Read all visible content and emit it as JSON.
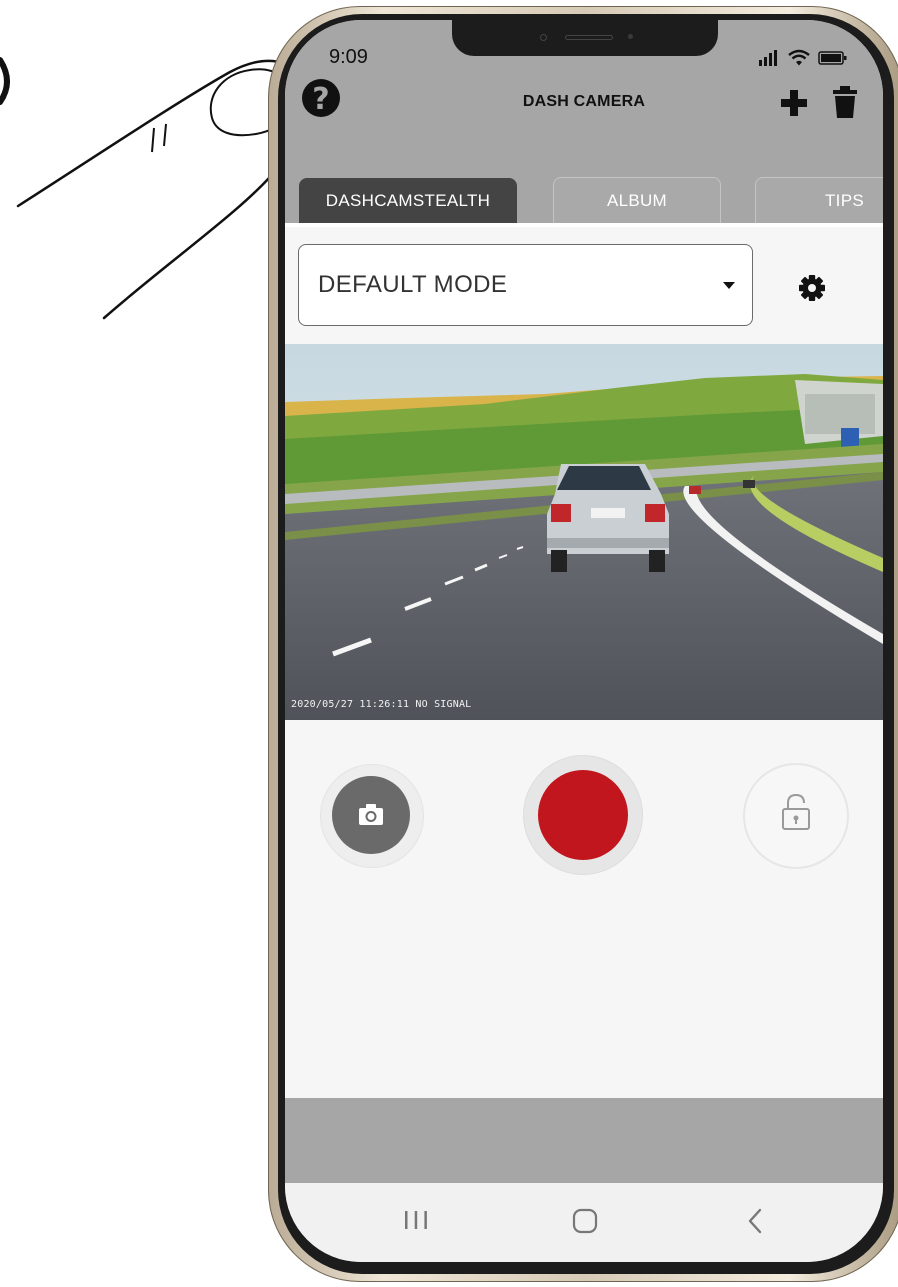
{
  "status_bar": {
    "time": "9:09"
  },
  "app": {
    "title": "DASH CAMERA"
  },
  "toolbar": {
    "help_icon": "help-icon",
    "add_icon": "add-icon",
    "delete_icon": "trash-icon"
  },
  "tabs": [
    {
      "label": "DASHCAMSTEALTH",
      "active": true
    },
    {
      "label": "ALBUM",
      "active": false
    },
    {
      "label": "TIPS",
      "active": false
    }
  ],
  "mode_select": {
    "selected": "DEFAULT MODE"
  },
  "camera": {
    "timestamp": "2020/05/27 11:26:11 NO SIGNAL"
  },
  "controls": {
    "snapshot_icon": "camera-icon",
    "record_color": "#c1161d",
    "lock_icon": "unlock-icon"
  },
  "nav": {
    "recent": "recent-apps-icon",
    "home": "home-icon",
    "back": "back-icon"
  },
  "colors": {
    "header": "#a6a6a6",
    "active_tab": "#444444",
    "record": "#c1161d"
  }
}
